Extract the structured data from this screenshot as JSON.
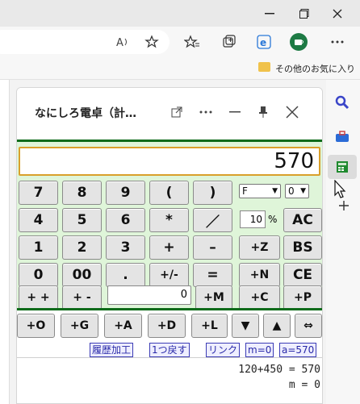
{
  "browser": {
    "favorites_bar": {
      "folder_label": "その他のお気に入り"
    }
  },
  "pane": {
    "title": "なにしろ電卓（計…",
    "display": "570"
  },
  "keys": {
    "row1": [
      "7",
      "8",
      "9",
      "(",
      ")"
    ],
    "row2": [
      "4",
      "5",
      "6",
      "*",
      "／",
      "AC"
    ],
    "row3": [
      "1",
      "2",
      "3",
      "+",
      "–",
      "+Z",
      "BS"
    ],
    "row4": [
      "0",
      "00",
      ".",
      "+/-",
      "=",
      "+N",
      "CE"
    ],
    "row5": [
      "+ +",
      "+ -",
      "+M",
      "+C",
      "+P"
    ],
    "extra": [
      "+O",
      "+G",
      "+A",
      "+D",
      "+L",
      "▼",
      "▲",
      "⇔"
    ]
  },
  "controls": {
    "mode_select": "F",
    "digits_select": "0",
    "percent_value": "10",
    "percent_unit": "%",
    "memory_value": "0"
  },
  "links": [
    "履歴加工",
    "1つ戻す",
    "リンク",
    "m=0",
    "a=570"
  ],
  "history": [
    "120+450 = 570",
    "m = 0"
  ]
}
